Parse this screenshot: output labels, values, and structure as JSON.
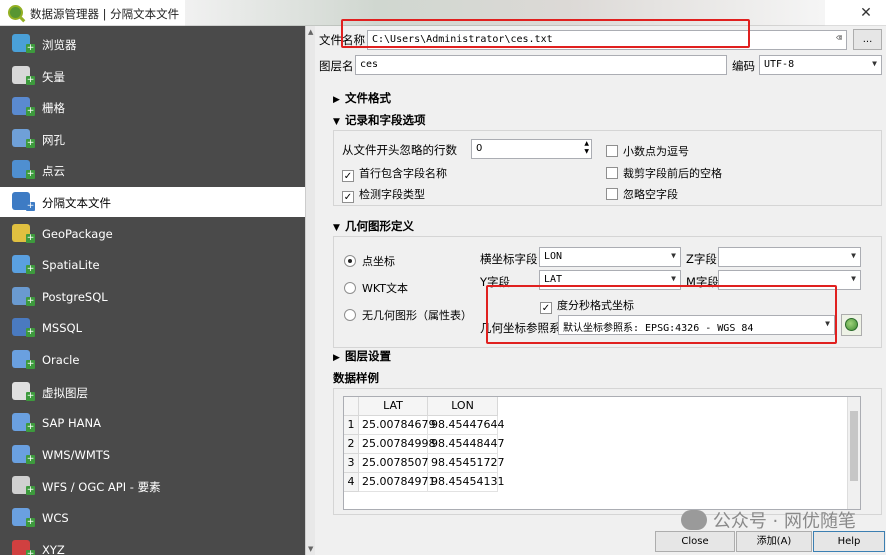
{
  "window": {
    "title": "数据源管理器 | 分隔文本文件"
  },
  "sidebar": {
    "items": [
      {
        "label": "浏览器",
        "icon": "folder-icon"
      },
      {
        "label": "矢量",
        "icon": "vector-icon"
      },
      {
        "label": "栅格",
        "icon": "raster-icon"
      },
      {
        "label": "网孔",
        "icon": "mesh-icon"
      },
      {
        "label": "点云",
        "icon": "point-cloud-icon"
      },
      {
        "label": "分隔文本文件",
        "icon": "delimited-text-icon",
        "selected": true
      },
      {
        "label": "GeoPackage",
        "icon": "geopackage-icon"
      },
      {
        "label": "SpatiaLite",
        "icon": "spatialite-icon"
      },
      {
        "label": "PostgreSQL",
        "icon": "postgresql-icon"
      },
      {
        "label": "MSSQL",
        "icon": "mssql-icon"
      },
      {
        "label": "Oracle",
        "icon": "oracle-icon"
      },
      {
        "label": "虚拟图层",
        "icon": "virtual-layer-icon"
      },
      {
        "label": "SAP HANA",
        "icon": "sap-hana-icon"
      },
      {
        "label": "WMS/WMTS",
        "icon": "wms-icon"
      },
      {
        "label": "WFS / OGC API - 要素",
        "icon": "wfs-icon"
      },
      {
        "label": "WCS",
        "icon": "wcs-icon"
      },
      {
        "label": "XYZ",
        "icon": "xyz-icon"
      }
    ]
  },
  "file": {
    "name_label": "文件名称",
    "path": "C:\\Users\\Administrator\\ces.txt",
    "browse_label": "...",
    "layer_label": "图层名",
    "layer_name": "ces",
    "encoding_label": "编码",
    "encoding": "UTF-8"
  },
  "sections": {
    "file_format": "文件格式",
    "records": "记录和字段选项",
    "geometry": "几何图形定义",
    "layer_settings": "图层设置",
    "sample": "数据样例"
  },
  "records": {
    "skip_label": "从文件开头忽略的行数",
    "skip_value": "0",
    "first_header": "首行包含字段名称",
    "first_header_checked": true,
    "detect_types": "检测字段类型",
    "detect_types_checked": true,
    "decimal_comma": "小数点为逗号",
    "decimal_comma_checked": false,
    "trim_fields": "裁剪字段前后的空格",
    "trim_fields_checked": false,
    "discard_empty": "忽略空字段",
    "discard_empty_checked": false
  },
  "geometry": {
    "point": "点坐标",
    "wkt": "WKT文本",
    "none": "无几何图形（属性表）",
    "selected": "point",
    "x_label": "横坐标字段",
    "x_value": "LON",
    "y_label": "Y字段",
    "y_value": "LAT",
    "z_label": "Z字段",
    "z_value": "",
    "m_label": "M字段",
    "m_value": "",
    "dms_label": "度分秒格式坐标",
    "dms_checked": true,
    "crs_label": "几何坐标参照系",
    "crs_value": "默认坐标参照系: EPSG:4326 - WGS 84"
  },
  "sample": {
    "columns": [
      "LAT",
      "LON"
    ],
    "rows": [
      [
        "1",
        "25.00784679",
        "98.45447644"
      ],
      [
        "2",
        "25.00784998",
        "98.45448447"
      ],
      [
        "3",
        "25.0078507",
        "98.45451727"
      ],
      [
        "4",
        "25.00784971",
        "98.45454131"
      ]
    ]
  },
  "buttons": {
    "close": "Close",
    "add": "添加(A)",
    "help": "Help"
  },
  "watermark": "公众号 · 网优随笔",
  "colors": {
    "highlight_box": "#e0201f",
    "sidebar_bg": "#4a4a4a"
  }
}
